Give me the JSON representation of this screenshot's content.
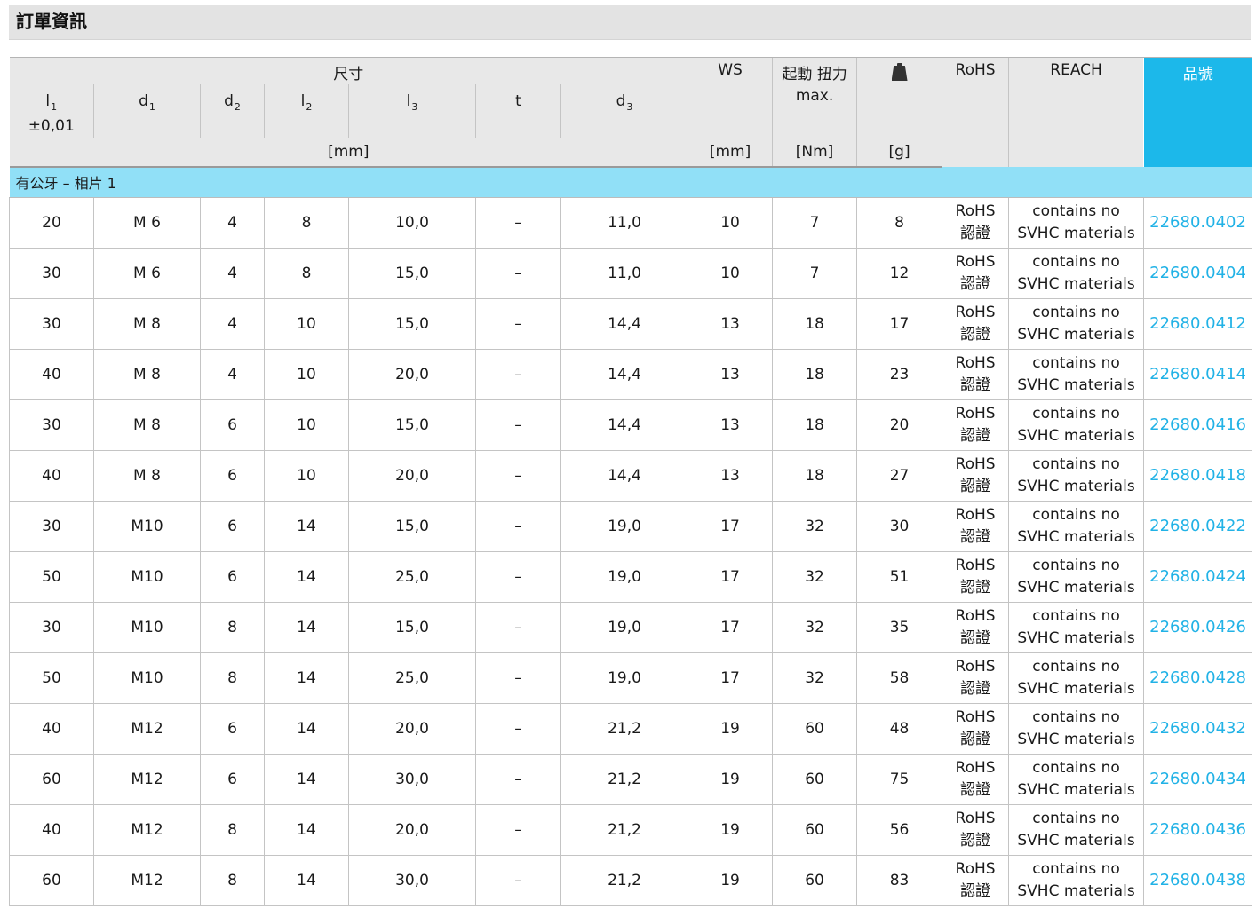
{
  "section_title": "訂單資訊",
  "header": {
    "dimensions": "尺寸",
    "l1_label": "l",
    "l1_sub": "1",
    "l1_tol": "±0,01",
    "d1_label": "d",
    "d1_sub": "1",
    "d2_label": "d",
    "d2_sub": "2",
    "l2_label": "l",
    "l2_sub": "2",
    "l3_label": "l",
    "l3_sub": "3",
    "t_label": "t",
    "d3_label": "d",
    "d3_sub": "3",
    "unit_mm_dims": "[mm]",
    "ws": "WS",
    "ws_unit": "[mm]",
    "torque_line1": "起動 扭力",
    "torque_line2": "max.",
    "torque_unit": "[Nm]",
    "weight_icon": "weight-icon",
    "weight_unit": "[g]",
    "rohs": "RoHS",
    "reach": "REACH",
    "part_no": "品號"
  },
  "group_label": "有公牙 – 相片 1",
  "rows": [
    {
      "l1": "20",
      "d1": "M 6",
      "d2": "4",
      "l2": "8",
      "l3": "10,0",
      "t": "–",
      "d3": "11,0",
      "ws": "10",
      "torque": "7",
      "weight": "8",
      "rohs1": "RoHS",
      "rohs2": "認證",
      "reach1": "contains no",
      "reach2": "SVHC materials",
      "part_no": "22680.0402"
    },
    {
      "l1": "30",
      "d1": "M 6",
      "d2": "4",
      "l2": "8",
      "l3": "15,0",
      "t": "–",
      "d3": "11,0",
      "ws": "10",
      "torque": "7",
      "weight": "12",
      "rohs1": "RoHS",
      "rohs2": "認證",
      "reach1": "contains no",
      "reach2": "SVHC materials",
      "part_no": "22680.0404"
    },
    {
      "l1": "30",
      "d1": "M 8",
      "d2": "4",
      "l2": "10",
      "l3": "15,0",
      "t": "–",
      "d3": "14,4",
      "ws": "13",
      "torque": "18",
      "weight": "17",
      "rohs1": "RoHS",
      "rohs2": "認證",
      "reach1": "contains no",
      "reach2": "SVHC materials",
      "part_no": "22680.0412"
    },
    {
      "l1": "40",
      "d1": "M 8",
      "d2": "4",
      "l2": "10",
      "l3": "20,0",
      "t": "–",
      "d3": "14,4",
      "ws": "13",
      "torque": "18",
      "weight": "23",
      "rohs1": "RoHS",
      "rohs2": "認證",
      "reach1": "contains no",
      "reach2": "SVHC materials",
      "part_no": "22680.0414"
    },
    {
      "l1": "30",
      "d1": "M 8",
      "d2": "6",
      "l2": "10",
      "l3": "15,0",
      "t": "–",
      "d3": "14,4",
      "ws": "13",
      "torque": "18",
      "weight": "20",
      "rohs1": "RoHS",
      "rohs2": "認證",
      "reach1": "contains no",
      "reach2": "SVHC materials",
      "part_no": "22680.0416"
    },
    {
      "l1": "40",
      "d1": "M 8",
      "d2": "6",
      "l2": "10",
      "l3": "20,0",
      "t": "–",
      "d3": "14,4",
      "ws": "13",
      "torque": "18",
      "weight": "27",
      "rohs1": "RoHS",
      "rohs2": "認證",
      "reach1": "contains no",
      "reach2": "SVHC materials",
      "part_no": "22680.0418"
    },
    {
      "l1": "30",
      "d1": "M10",
      "d2": "6",
      "l2": "14",
      "l3": "15,0",
      "t": "–",
      "d3": "19,0",
      "ws": "17",
      "torque": "32",
      "weight": "30",
      "rohs1": "RoHS",
      "rohs2": "認證",
      "reach1": "contains no",
      "reach2": "SVHC materials",
      "part_no": "22680.0422"
    },
    {
      "l1": "50",
      "d1": "M10",
      "d2": "6",
      "l2": "14",
      "l3": "25,0",
      "t": "–",
      "d3": "19,0",
      "ws": "17",
      "torque": "32",
      "weight": "51",
      "rohs1": "RoHS",
      "rohs2": "認證",
      "reach1": "contains no",
      "reach2": "SVHC materials",
      "part_no": "22680.0424"
    },
    {
      "l1": "30",
      "d1": "M10",
      "d2": "8",
      "l2": "14",
      "l3": "15,0",
      "t": "–",
      "d3": "19,0",
      "ws": "17",
      "torque": "32",
      "weight": "35",
      "rohs1": "RoHS",
      "rohs2": "認證",
      "reach1": "contains no",
      "reach2": "SVHC materials",
      "part_no": "22680.0426"
    },
    {
      "l1": "50",
      "d1": "M10",
      "d2": "8",
      "l2": "14",
      "l3": "25,0",
      "t": "–",
      "d3": "19,0",
      "ws": "17",
      "torque": "32",
      "weight": "58",
      "rohs1": "RoHS",
      "rohs2": "認證",
      "reach1": "contains no",
      "reach2": "SVHC materials",
      "part_no": "22680.0428"
    },
    {
      "l1": "40",
      "d1": "M12",
      "d2": "6",
      "l2": "14",
      "l3": "20,0",
      "t": "–",
      "d3": "21,2",
      "ws": "19",
      "torque": "60",
      "weight": "48",
      "rohs1": "RoHS",
      "rohs2": "認證",
      "reach1": "contains no",
      "reach2": "SVHC materials",
      "part_no": "22680.0432"
    },
    {
      "l1": "60",
      "d1": "M12",
      "d2": "6",
      "l2": "14",
      "l3": "30,0",
      "t": "–",
      "d3": "21,2",
      "ws": "19",
      "torque": "60",
      "weight": "75",
      "rohs1": "RoHS",
      "rohs2": "認證",
      "reach1": "contains no",
      "reach2": "SVHC materials",
      "part_no": "22680.0434"
    },
    {
      "l1": "40",
      "d1": "M12",
      "d2": "8",
      "l2": "14",
      "l3": "20,0",
      "t": "–",
      "d3": "21,2",
      "ws": "19",
      "torque": "60",
      "weight": "56",
      "rohs1": "RoHS",
      "rohs2": "認證",
      "reach1": "contains no",
      "reach2": "SVHC materials",
      "part_no": "22680.0436"
    },
    {
      "l1": "60",
      "d1": "M12",
      "d2": "8",
      "l2": "14",
      "l3": "30,0",
      "t": "–",
      "d3": "21,2",
      "ws": "19",
      "torque": "60",
      "weight": "83",
      "rohs1": "RoHS",
      "rohs2": "認證",
      "reach1": "contains no",
      "reach2": "SVHC materials",
      "part_no": "22680.0438"
    }
  ],
  "colors": {
    "header_bg": "#e8e8e8",
    "group_bg": "#91e0f7",
    "part_no_header_bg": "#1cb8ea",
    "part_no_link": "#21b2e6"
  }
}
